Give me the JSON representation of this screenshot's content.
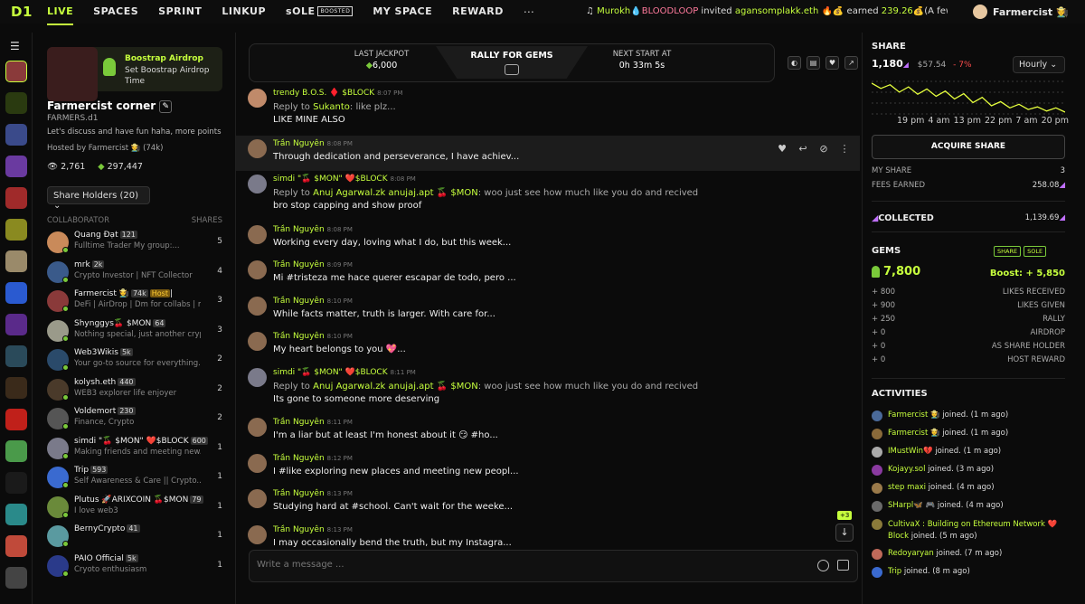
{
  "app": {
    "logo": "D1"
  },
  "nav": [
    {
      "label": "LIVE",
      "active": true
    },
    {
      "label": "SPACES"
    },
    {
      "label": "SPRINT"
    },
    {
      "label": "LINKUP"
    },
    {
      "label": "sOLE",
      "badge": "Boosted"
    },
    {
      "label": "MY SPACE"
    },
    {
      "label": "REWARD"
    }
  ],
  "more_icon": "⋯",
  "ticker": {
    "actor": "Murokh",
    "actor_tag": "💧BLOODLOOP",
    "verb": "invited",
    "target": "agansomplakk.eth",
    "mid": "🔥💰 earned",
    "amount": "239.26",
    "tail": "💰(A few..."
  },
  "current_user": {
    "name": "Farmercist 🧑‍🌾"
  },
  "boost": {
    "title": "Boostrap Airdrop",
    "subtitle": "Set Boostrap Airdrop Time"
  },
  "corner": {
    "title": "Farmercist corner",
    "handle": "FARMERS.d1",
    "description": "Let's discuss and have fun haha, more points f...",
    "hosted_by": "Hosted by Farmercist 🧑‍🌾 (74k)",
    "views": "2,761",
    "gems": "297,447",
    "share_holders_label": "Share Holders (20)"
  },
  "collab_header": {
    "left": "COLLABORATOR",
    "right": "SHARES"
  },
  "collaborators": [
    {
      "name": "Quang Đạt",
      "badge": "121",
      "bio": "Fulltime Trader My group:...",
      "shares": "5",
      "color": "#c98a5a"
    },
    {
      "name": "mrk",
      "badge": "2k",
      "bio": "Crypto Investor | NFT Collector",
      "shares": "4",
      "color": "#3a5a8a"
    },
    {
      "name": "Farmercist 🧑‍🌾",
      "badge": "74k",
      "host": "Host",
      "extra": "|",
      "bio": "DeFi | AirDrop | Dm for collabs | my...",
      "shares": "3",
      "color": "#8a3a3a"
    },
    {
      "name": "Shynggys🍒 $MON",
      "badge": "64",
      "bio": "Nothing special, just another crypto...",
      "shares": "3",
      "color": "#9a9a8a"
    },
    {
      "name": "Web3Wikis",
      "badge": "5k",
      "bio": "Your go-to source for everything...",
      "shares": "2",
      "color": "#2a4a6a"
    },
    {
      "name": "kolysh.eth",
      "badge": "440",
      "bio": "WEB3 explorer life enjoyer",
      "shares": "2",
      "color": "#4a3a2a"
    },
    {
      "name": "Voldemort",
      "badge": "230",
      "bio": "Finance, Crypto",
      "shares": "2",
      "color": "#555555"
    },
    {
      "name": "simdi \"🍒 $MON\" ❤️$BLOCK",
      "badge": "600",
      "bio": "Making friends and meeting new...",
      "shares": "1",
      "color": "#7a7a8a"
    },
    {
      "name": "Trip",
      "badge": "593",
      "bio": "Self Awareness & Care || Crypto...",
      "shares": "1",
      "color": "#3a6ad0"
    },
    {
      "name": "Plutus 🚀ARIXCOIN 🍒$MON",
      "badge": "79",
      "bio": "I love web3",
      "shares": "1",
      "color": "#6a8a3a"
    },
    {
      "name": "BernyCrypto",
      "badge": "41",
      "bio": "",
      "shares": "1",
      "color": "#5a9aa0"
    },
    {
      "name": "PAIO Official",
      "badge": "5k",
      "bio": "Cryoto enthusiasm",
      "shares": "1",
      "color": "#2a3a8a"
    }
  ],
  "rally": {
    "title": "RALLY FOR GEMS",
    "last_jackpot_label": "LAST JACKPOT",
    "last_jackpot_value": "6,000",
    "next_start_label": "NEXT START AT",
    "next_start_value": "0h 33m 5s"
  },
  "messages": [
    {
      "author": "trendy B.O.S. ♦️ $BLOCK",
      "time": "8:07 PM",
      "reply_prefix": "Reply to",
      "reply_to": "Sukanto",
      "reply_text": ": like plz...",
      "text": "LIKE MINE ALSO"
    },
    {
      "author": "Trần Nguyên",
      "time": "8:08 PM",
      "text": "Through dedication and perseverance, I have achiev..."
    },
    {
      "author": "simdi \"🍒 $MON\" ❤️$BLOCK",
      "time": "8:08 PM",
      "reply_prefix": "Reply to",
      "reply_to": "Anuj Agarwal.zk anujaj.apt 🍒 $MON",
      "reply_text": ": woo just see how much like you do and recived",
      "text": "bro stop capping and show proof"
    },
    {
      "author": "Trần Nguyên",
      "time": "8:08 PM",
      "text": "Working every day, loving what I do, but this week..."
    },
    {
      "author": "Trần Nguyên",
      "time": "8:09 PM",
      "text": "Mi #tristeza me hace querer escapar de todo, pero ..."
    },
    {
      "author": "Trần Nguyên",
      "time": "8:10 PM",
      "text": "While facts matter, truth is larger. With care for..."
    },
    {
      "author": "Trần Nguyên",
      "time": "8:10 PM",
      "text": "My heart belongs to you 💖..."
    },
    {
      "author": "simdi \"🍒 $MON\" ❤️$BLOCK",
      "time": "8:11 PM",
      "reply_prefix": "Reply to",
      "reply_to": "Anuj Agarwal.zk anujaj.apt 🍒 $MON",
      "reply_text": ": woo just see how much like you do and recived",
      "text": "Its gone to someone more deserving"
    },
    {
      "author": "Trần Nguyên",
      "time": "8:11 PM",
      "text": "I'm a liar but at least I'm honest about it 😏 #ho..."
    },
    {
      "author": "Trần Nguyên",
      "time": "8:12 PM",
      "text": "I #like exploring new places and meeting new peopl..."
    },
    {
      "author": "Trần Nguyên",
      "time": "8:13 PM",
      "text": "Studying hard at #school. Can't wait for the weeke..."
    },
    {
      "author": "Trần Nguyên",
      "time": "8:13 PM",
      "text": "I may occasionally bend the truth, but my Instagra..."
    }
  ],
  "new_count": "+3",
  "composer": {
    "placeholder": "Write a message ..."
  },
  "share": {
    "title": "SHARE",
    "price": "1,180",
    "usd": "$57.54",
    "change": "- 7%",
    "interval": "Hourly",
    "xticks": [
      "19 pm",
      "4 am",
      "13 pm",
      "22 pm",
      "7 am",
      "20 pm"
    ],
    "acquire_label": "ACQUIRE SHARE",
    "my_share_label": "MY SHARE",
    "my_share_value": "3",
    "fees_label": "FEES EARNED",
    "fees_value": "258.08"
  },
  "collected": {
    "label": "COLLECTED",
    "value": "1,139.69"
  },
  "gems": {
    "title": "GEMS",
    "badges": [
      "SHARE",
      "SOLE"
    ],
    "total": "7,800",
    "boost": "Boost: + 5,850",
    "rows": [
      {
        "value": "+ 800",
        "label": "LIKES RECEIVED"
      },
      {
        "value": "+ 900",
        "label": "LIKES GIVEN"
      },
      {
        "value": "+ 250",
        "label": "RALLY"
      },
      {
        "value": "+ 0",
        "label": "AIRDROP"
      },
      {
        "value": "+ 0",
        "label": "AS SHARE HOLDER"
      },
      {
        "value": "+ 0",
        "label": "HOST REWARD"
      }
    ]
  },
  "activities": {
    "title": "ACTIVITIES",
    "items": [
      {
        "name": "Farmercist 🧑‍🌾",
        "text": "joined. (1 m ago)"
      },
      {
        "name": "Farmercist 🧑‍🌾",
        "text": "joined. (1 m ago)"
      },
      {
        "name": "IMustWin💔",
        "text": "joined. (1 m ago)"
      },
      {
        "name": "Kojayy.sol",
        "text": "joined. (3 m ago)"
      },
      {
        "name": "step maxi",
        "text": "joined. (4 m ago)"
      },
      {
        "name": "SHarpl🦋 🎮",
        "text": "joined. (4 m ago)"
      },
      {
        "name": "CultivaX : Building on Ethereum Network ❤️ Block",
        "text": "joined. (5 m ago)",
        "two": true
      },
      {
        "name": "Redoyaryan",
        "text": "joined. (7 m ago)"
      },
      {
        "name": "Trip",
        "text": "joined. (8 m ago)"
      }
    ]
  },
  "chart_data": {
    "type": "line",
    "categories": [
      "19 pm",
      "4 am",
      "13 pm",
      "22 pm",
      "7 am",
      "20 pm"
    ],
    "series": [
      {
        "values": [
          1235,
          1225,
          1232,
          1218,
          1228,
          1214,
          1224,
          1210,
          1220,
          1205,
          1215,
          1198,
          1208,
          1192,
          1200,
          1188,
          1195,
          1185,
          1190,
          1182,
          1188,
          1180
        ]
      }
    ],
    "color": "#e6ff3d"
  }
}
